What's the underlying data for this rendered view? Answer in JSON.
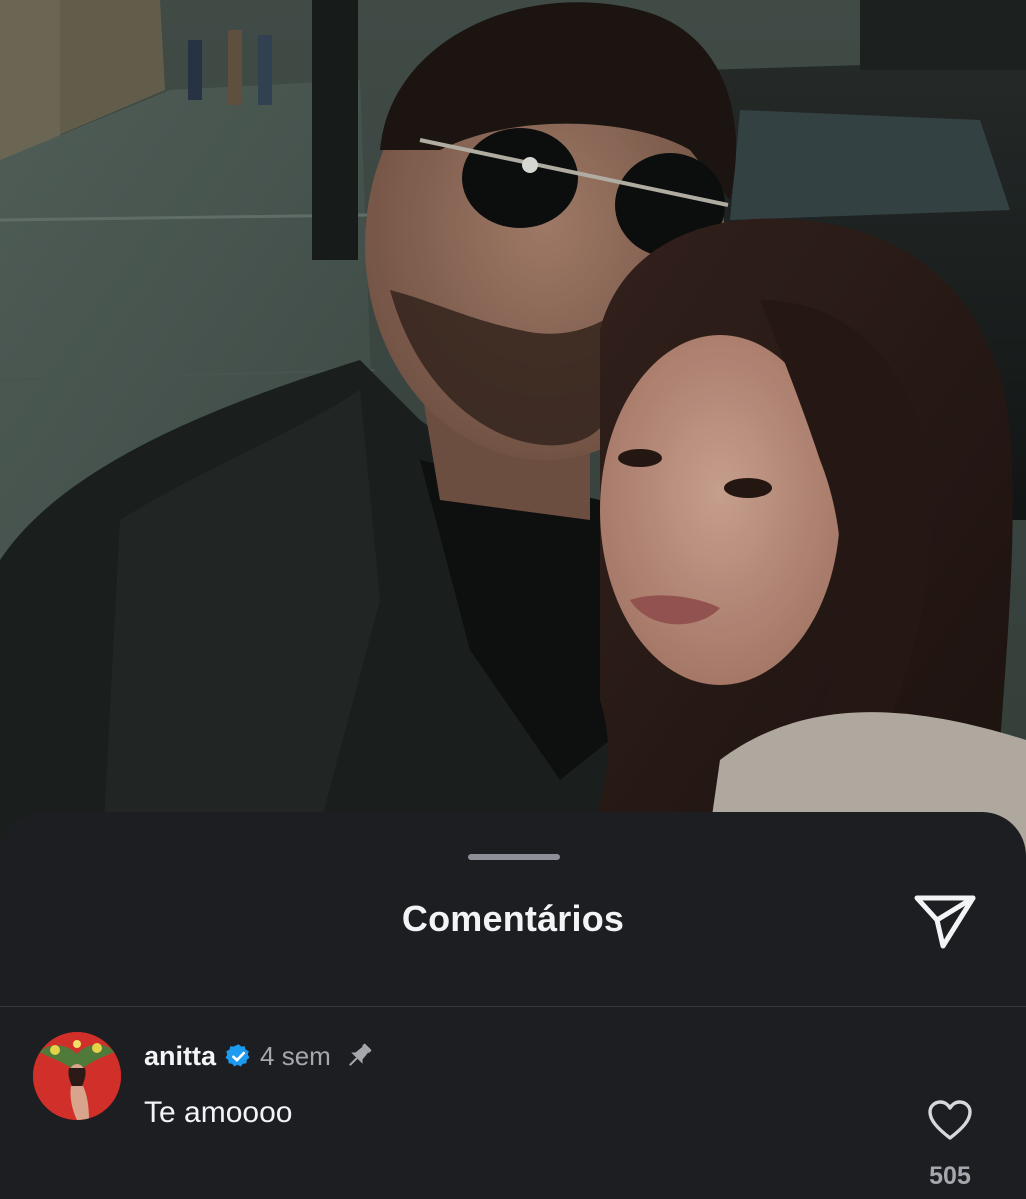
{
  "post": {
    "photo_description_icon": "post-photo"
  },
  "comments_sheet": {
    "title": "Comentários",
    "share_icon": "paper-plane-icon"
  },
  "comments": [
    {
      "username": "anitta",
      "verified": true,
      "timestamp": "4 sem",
      "pinned": true,
      "text": "Te amoooo",
      "like_count": "505"
    }
  ],
  "colors": {
    "sheet_background": "#1c1e22",
    "text_primary": "#f3f4f6",
    "text_secondary": "#a4a7ad",
    "verified_blue": "#1d9bf0"
  }
}
